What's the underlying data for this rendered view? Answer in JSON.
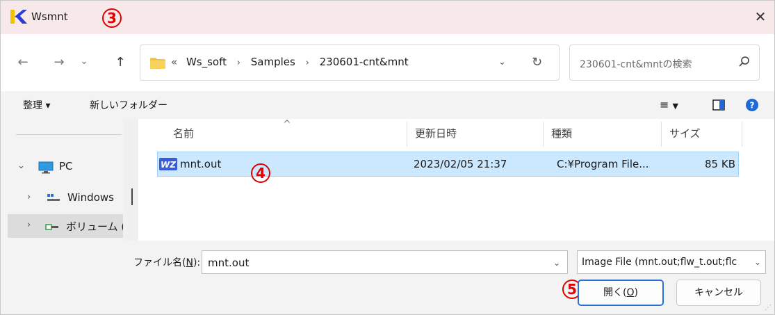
{
  "window": {
    "title": "Wsmnt",
    "close_glyph": "✕",
    "brand_colors": {
      "logo_blue": "#2b3dd9",
      "logo_yellow": "#f2c200",
      "titlebar_bg": "#f7e9ea"
    }
  },
  "callouts": {
    "c3": "3",
    "c4": "4",
    "c5": "5"
  },
  "nav": {
    "back_icon": "←",
    "forward_icon": "→",
    "recent_icon": "⌄",
    "up_icon": "↑"
  },
  "address": {
    "prefix": "«",
    "crumbs": [
      "Ws_soft",
      "Samples",
      "230601-cnt&mnt"
    ],
    "dropdown_glyph": "⌄",
    "refresh_glyph": "↻"
  },
  "search": {
    "placeholder": "230601-cnt&mntの検索"
  },
  "toolbar": {
    "organize_label": "整理 ▾",
    "new_folder_label": "新しいフォルダー"
  },
  "navpane": {
    "items": [
      {
        "chevron": "⌄",
        "label": "PC"
      },
      {
        "chevron": "›",
        "label": "Windows"
      },
      {
        "chevron": "›",
        "label": "ボリューム (I"
      }
    ]
  },
  "filelist": {
    "columns": [
      "名前",
      "更新日時",
      "種類",
      "サイズ"
    ],
    "sort_glyph": "^",
    "rows": [
      {
        "name": "mnt.out",
        "modified": "2023/02/05 21:37",
        "type": "C:¥Program File...",
        "size": "85 KB"
      }
    ]
  },
  "bottom": {
    "filename_label_pre": "ファイル名(",
    "filename_label_key": "N",
    "filename_label_post": "):",
    "filename_value": "mnt.out",
    "dropdown_glyph": "⌄",
    "filetype_value": "Image File (mnt.out;flw_t.out;flc",
    "open_label_pre": "開く(",
    "open_label_key": "O",
    "open_label_post": ")",
    "cancel_label": "キャンセル"
  }
}
